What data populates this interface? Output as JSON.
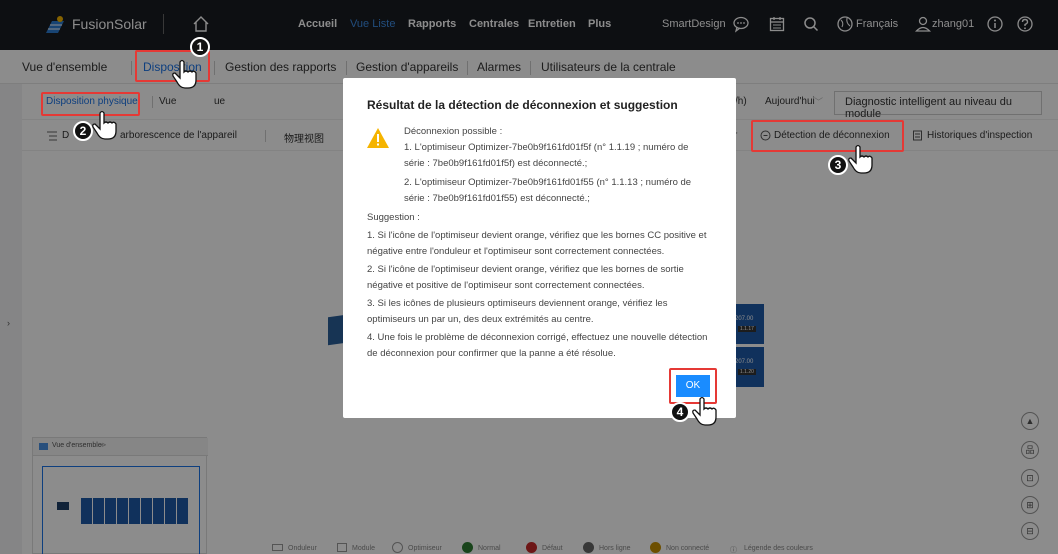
{
  "topbar": {
    "brand": "FusionSolar",
    "nav": [
      "Accueil",
      "Vue Liste",
      "Rapports",
      "Centrales",
      "Entretien",
      "Plus"
    ],
    "active_nav": "Vue Liste",
    "workspace": "SmartDesign",
    "language": "Français",
    "user": "zhang01"
  },
  "subtabs": [
    "Vue d'ensemble",
    "Disposition",
    "Gestion des rapports",
    "Gestion d'appareils",
    "Alarmes",
    "Utilisateurs de la centrale"
  ],
  "layout_tabs": {
    "physical": "Disposition physique",
    "logical_partial": "Vue",
    "logical_tail": "ue"
  },
  "toolbar": {
    "tree_partial": "D",
    "tree_tail": "arborescence de l'appareil",
    "physical_view": "物理视图",
    "unit_tail": "/h)",
    "today": "Aujourd'hui",
    "diagnose": "Diagnostic intelligent au niveau du module",
    "r_partial": "r",
    "disconnect_detect": "Détection de déconnexion",
    "inspection_history": "Historiques d'inspection"
  },
  "modal": {
    "title": "Résultat de la détection de déconnexion et suggestion",
    "head": "Déconnexion possible :",
    "item1": "1. L'optimiseur Optimizer-7be0b9f161fd01f5f (n° 1.1.19 ; numéro de série : 7be0b9f161fd01f5f) est déconnecté.;",
    "item2": "2. L'optimiseur Optimizer-7be0b9f161fd01f55 (n° 1.1.13 ; numéro de série : 7be0b9f161fd01f55) est déconnecté.;",
    "suggestion_label": "Suggestion :",
    "s1": "1. Si l'icône de l'optimiseur devient orange, vérifiez que les bornes CC positive et négative entre l'onduleur et l'optimiseur sont correctement connectées.",
    "s2": "2. Si l'icône de l'optimiseur devient orange, vérifiez que les bornes de sortie négative et positive de l'optimiseur sont correctement connectées.",
    "s3": "3. Si les icônes de plusieurs optimiseurs deviennent orange, vérifiez les optimiseurs un par un, des deux extrémités au centre.",
    "s4": "4. Une fois le problème de déconnexion corrigé, effectuez une nouvelle détection de déconnexion pour confirmer que la panne a été résolue.",
    "ok": "OK"
  },
  "canvas": {
    "module_value": "207.00",
    "module_id_a": "1.1.17",
    "module_id_b": "1.1.20"
  },
  "overview_panel": {
    "title": "Vue d'ensemble"
  },
  "legend": [
    "Onduleur",
    "Module",
    "Optimiseur",
    "Normal",
    "Défaut",
    "Hors ligne",
    "Non connecté",
    "Légende des couleurs"
  ],
  "steps": [
    "1",
    "2",
    "3",
    "4"
  ],
  "colors": {
    "accent": "#1a8cff",
    "highlight": "#e53935",
    "topbar": "#191c22"
  }
}
